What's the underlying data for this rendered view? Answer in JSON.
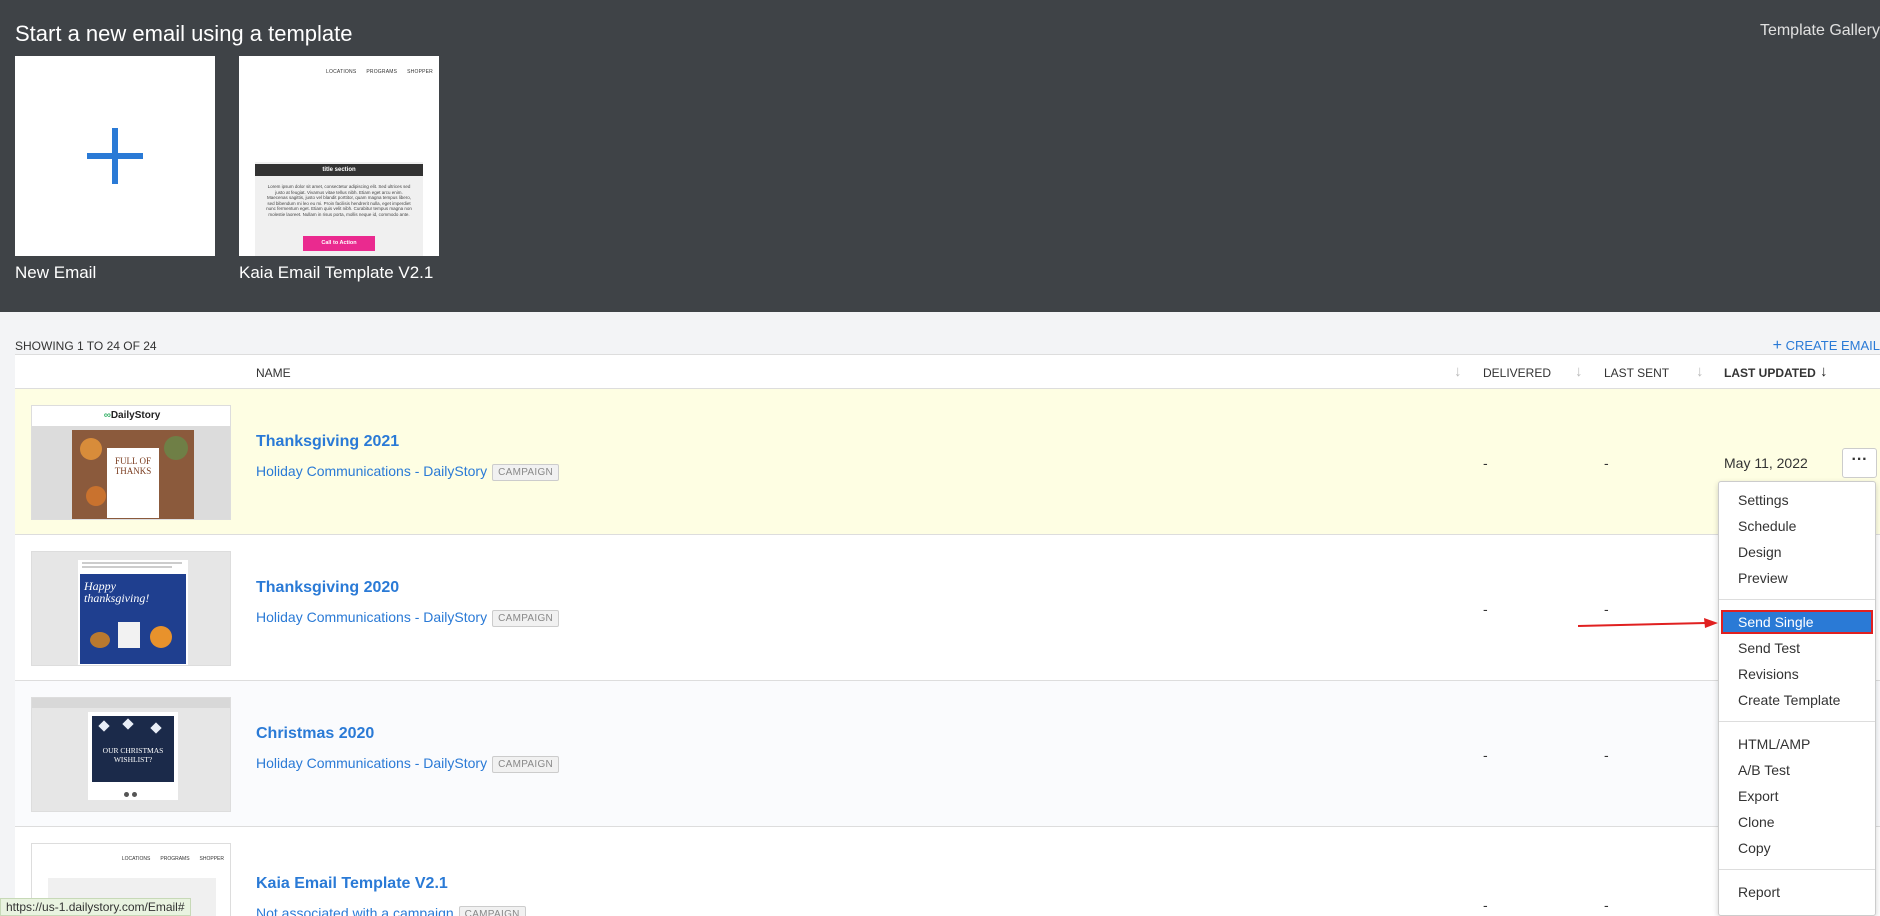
{
  "gallery": {
    "title": "Start a new email using a template",
    "link": "Template Gallery",
    "templates": [
      {
        "name": "New Email"
      },
      {
        "name": "Kaia Email Template V2.1"
      }
    ],
    "preview": {
      "nav": [
        "LOCATIONS",
        "PROGRAMS",
        "SHOPPER"
      ],
      "section_title": "title section",
      "body_text": "Lorem ipsum dolor sit amet, consectetur adipiscing elit. Sed ultrices sed justo at feugiat. Vivamus vitae tellus nibh. Etiam eget arcu enim. Maecenas sagittis, justo vel blandit porttitor, quam magna tempus libero, sed bibendum mi leo eu mi. Proin facilisis hendrerit nulla, eget imperdiet nunc fermentum eget. Etiam quis velit nibh. Curabitur tempus magna non molestie laoreet. Nullam in risus porta, mollis neque id, commodo ante.",
      "cta": "Call to Action"
    }
  },
  "list": {
    "showing": "SHOWING 1 TO 24 OF 24",
    "create": "CREATE EMAIL",
    "columns": {
      "name": "NAME",
      "delivered": "DELIVERED",
      "last_sent": "LAST SENT",
      "last_updated": "LAST UPDATED"
    },
    "rows": [
      {
        "name": "Thanksgiving 2021",
        "campaign": "Holiday Communications - DailyStory",
        "badge": "CAMPAIGN",
        "delivered": "-",
        "last_sent": "-",
        "last_updated": "May 11, 2022",
        "thumb_brand": "DailyStory",
        "thumb_text": "FULL OF THANKS"
      },
      {
        "name": "Thanksgiving 2020",
        "campaign": "Holiday Communications - DailyStory",
        "badge": "CAMPAIGN",
        "delivered": "-",
        "last_sent": "-",
        "last_updated": "",
        "thumb_text": "Happy thanksgiving!"
      },
      {
        "name": "Christmas 2020",
        "campaign": "Holiday Communications - DailyStory",
        "badge": "CAMPAIGN",
        "delivered": "-",
        "last_sent": "-",
        "last_updated": "",
        "thumb_text": "OUR CHRISTMAS WISHLIST?"
      },
      {
        "name": "Kaia Email Template V2.1",
        "campaign": "Not associated with a campaign",
        "badge": "CAMPAIGN",
        "delivered": "-",
        "last_sent": "-",
        "last_updated": ""
      }
    ]
  },
  "menu": {
    "groups": [
      [
        "Settings",
        "Schedule",
        "Design",
        "Preview"
      ],
      [
        "Send Single",
        "Send Test",
        "Revisions",
        "Create Template"
      ],
      [
        "HTML/AMP",
        "A/B Test",
        "Export",
        "Clone",
        "Copy"
      ],
      [
        "Report"
      ]
    ],
    "active": "Send Single"
  },
  "status_url": "https://us-1.dailystory.com/Email#",
  "colors": {
    "accent": "#2a7ad6",
    "header_bg": "#3f4347",
    "highlight_row": "#fefee3",
    "annotation_red": "#e02020",
    "cta_pink": "#ea2a8f"
  },
  "icons": [
    "plus-icon",
    "sort-arrow-icon",
    "more-icon",
    "annotation-arrow-icon"
  ]
}
